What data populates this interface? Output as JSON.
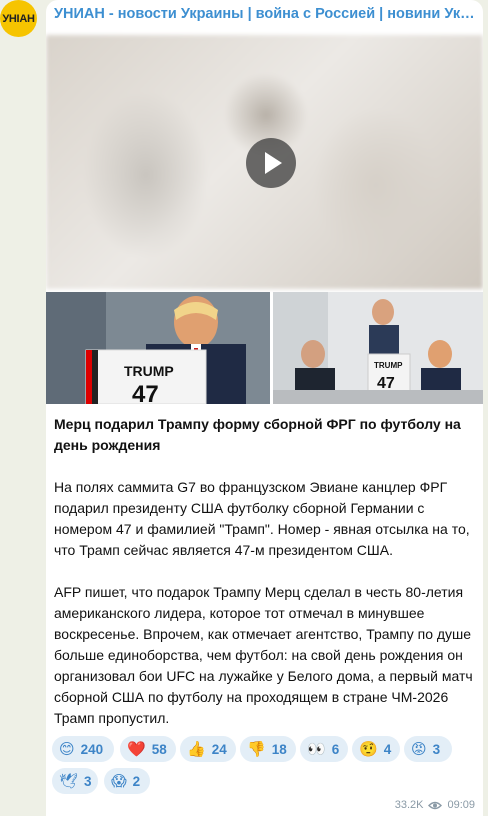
{
  "channel": {
    "name": "УНИАН - новости Украины | война с Россией | новини України..."
  },
  "avatar": {
    "text": "УНІАН"
  },
  "post": {
    "headline": "Мерц подарил Трампу форму сборной ФРГ по футболу на день рождения",
    "paragraphs": [
      "На полях саммита G7 во французском Эвиане канцлер ФРГ подарил президенту США футболку сборной Германии с номером 47 и фамилией \"Трамп\". Номер - явная отсылка на то, что Трамп сейчас является 47-м президентом США.",
      "AFP пишет, что подарок Трампу Мерц сделал в честь 80-летия американского лидера, которое тот отмечал в минувшее воскресенье. Впрочем, как отмечает агентство, Трампу по душе больше единоборства, чем футбол: на свой день рождения он организовал бои UFC на лужайке у Белого дома, а первый матч сборной США по футболу на проходящем в стране ЧМ-2026 Трамп пропустил."
    ],
    "photo1": {
      "jersey_name": "TRUMP",
      "jersey_number": "47"
    },
    "photo2": {
      "jersey_name": "TRUMP",
      "jersey_number": "47"
    },
    "reactions": [
      {
        "emoji": "😊",
        "count": "240"
      },
      {
        "emoji": "❤️",
        "count": "58"
      },
      {
        "emoji": "👍",
        "count": "24"
      },
      {
        "emoji": "👎",
        "count": "18"
      },
      {
        "emoji": "👀",
        "count": "6"
      },
      {
        "emoji": "🤨",
        "count": "4"
      },
      {
        "emoji": "😡",
        "count": "3"
      },
      {
        "emoji": "🕊",
        "count": "3"
      },
      {
        "emoji": "😱",
        "count": "2"
      }
    ],
    "views": "33.2K",
    "time": "09:09"
  },
  "colors": {
    "accent": "#3d8fd1",
    "chip_bg": "#e3eef7",
    "avatar_bg": "#f6c400"
  }
}
